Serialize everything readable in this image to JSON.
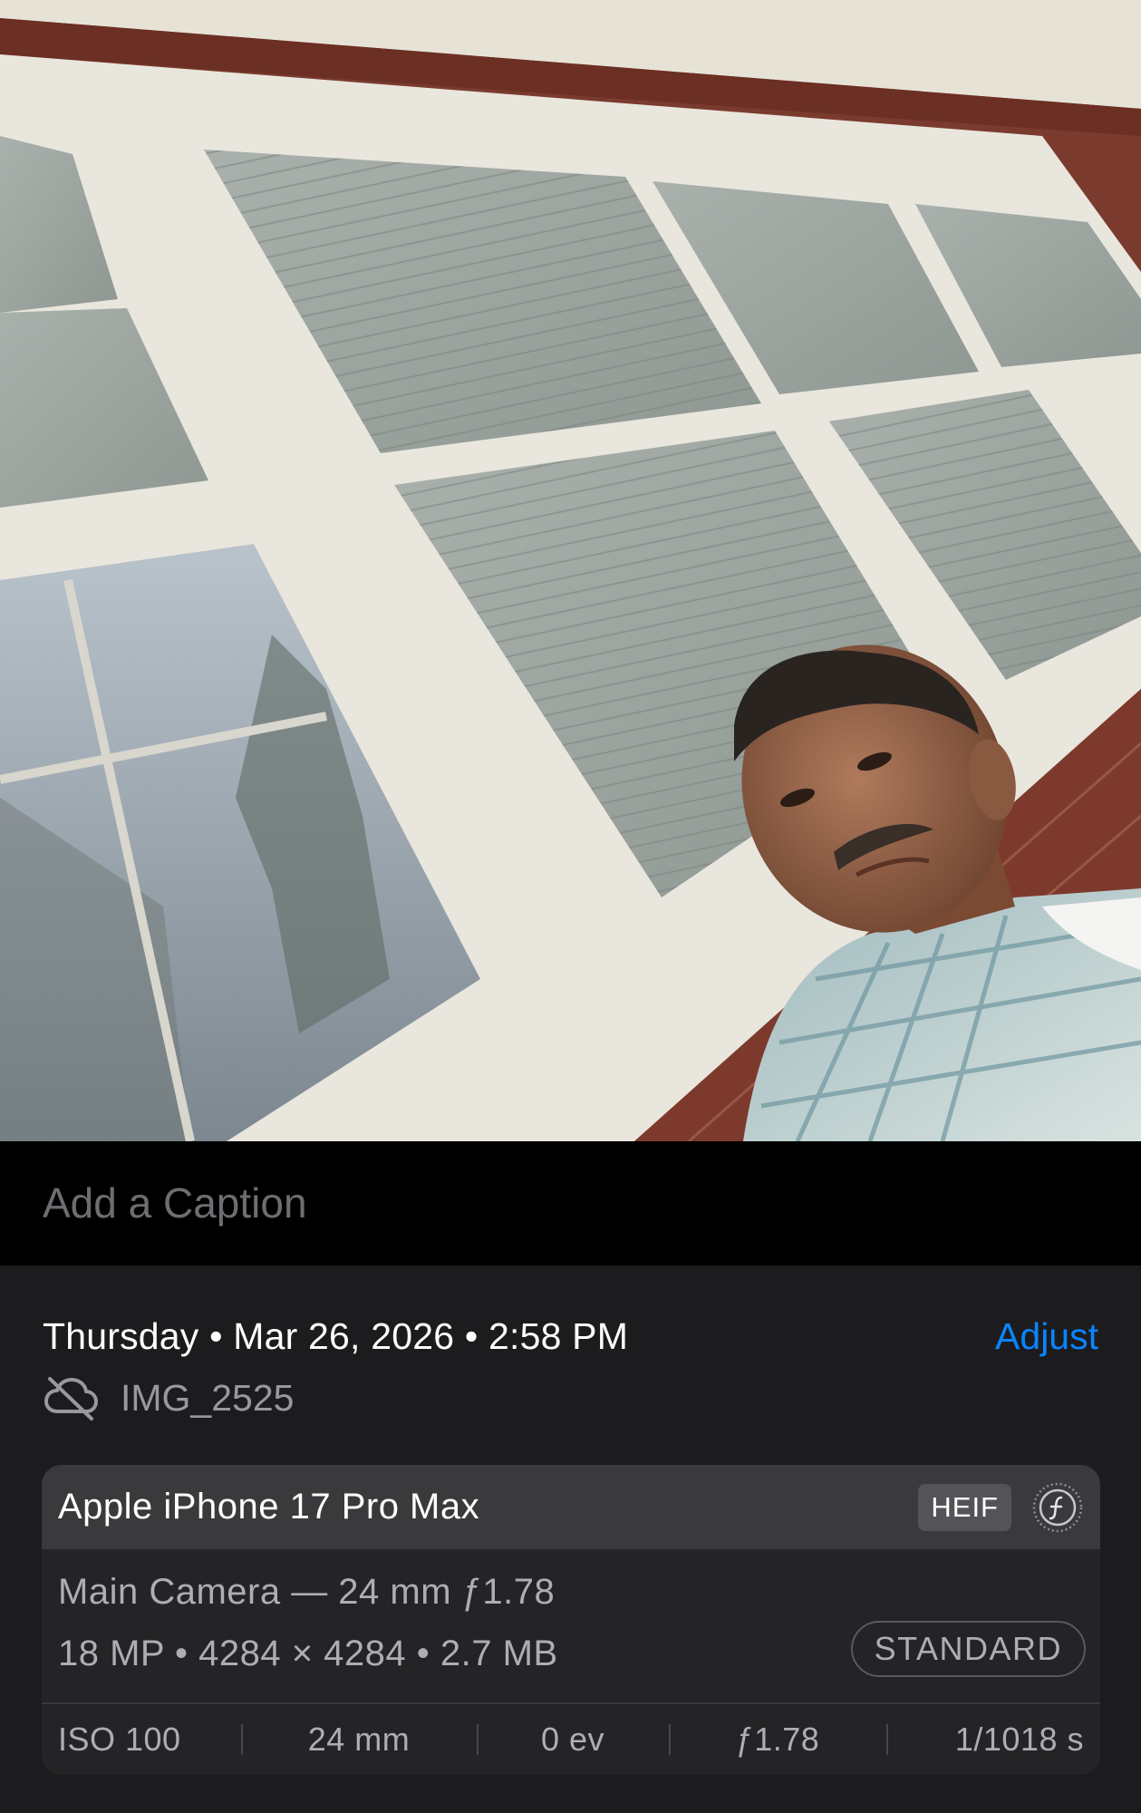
{
  "caption": {
    "placeholder": "Add a Caption"
  },
  "info": {
    "date_text": "Thursday • Mar 26, 2026 • 2:58 PM",
    "adjust_label": "Adjust",
    "file_name": "IMG_2525",
    "cloud_status_icon": "cloud-slash-icon"
  },
  "camera": {
    "device": "Apple iPhone 17 Pro Max",
    "format": "HEIF",
    "style_icon": "photographic-style-icon",
    "lens": "Main Camera — 24 mm ƒ1.78",
    "specs": "18 MP • 4284 × 4284 • 2.7 MB",
    "mode": "STANDARD",
    "exif": {
      "iso": "ISO 100",
      "focal": "24 mm",
      "ev": "0 ev",
      "aperture": "ƒ1.78",
      "shutter": "1/1018 s"
    }
  },
  "colors": {
    "accent": "#0a84ff",
    "panel": "#1c1c1e",
    "card": "#242426",
    "card_header": "#3a3a3c",
    "secondary_text": "#aeaeb2"
  }
}
